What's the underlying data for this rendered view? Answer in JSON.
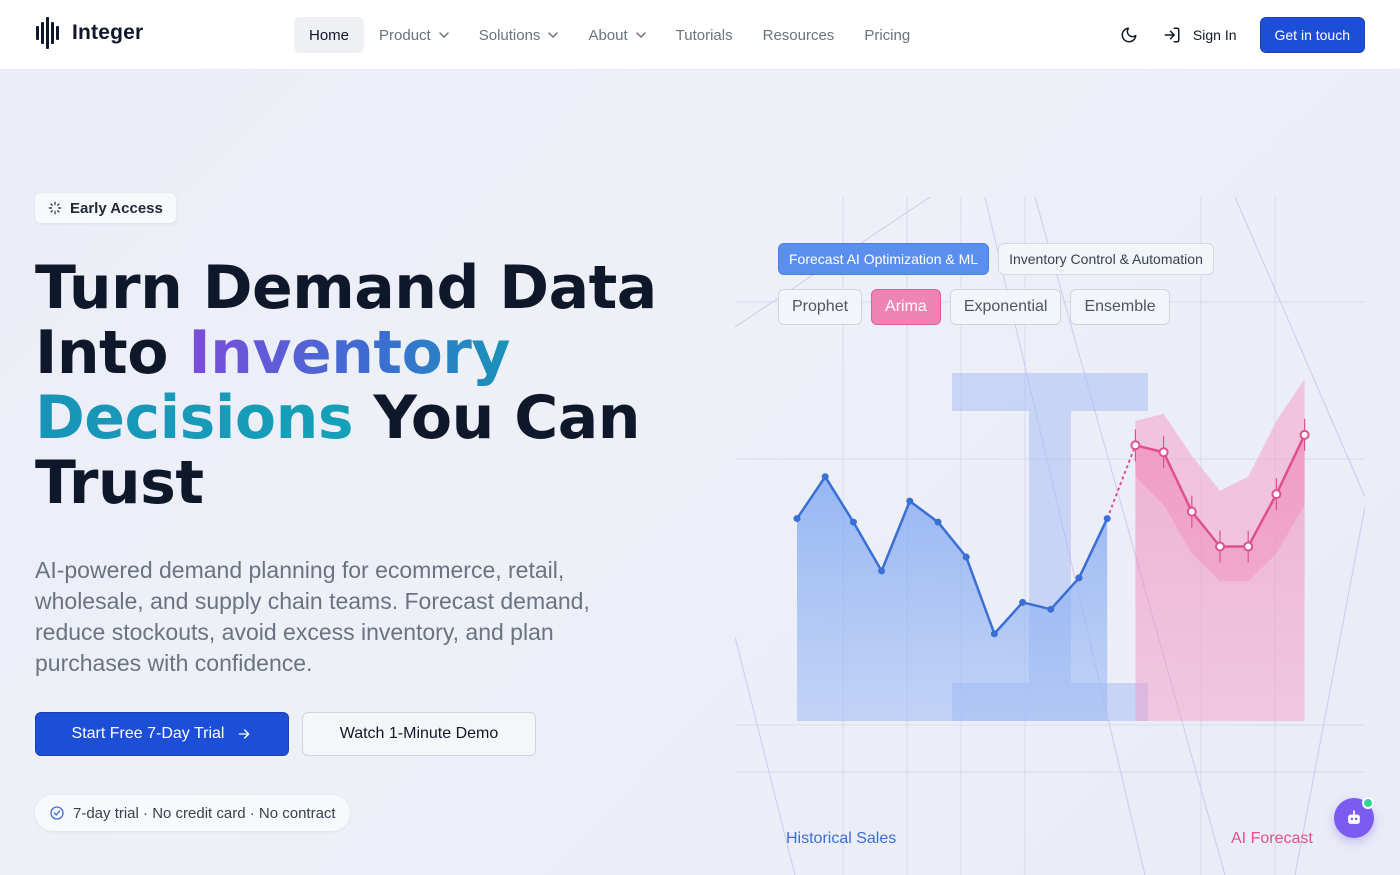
{
  "brand": {
    "name": "Integer"
  },
  "nav": {
    "links": [
      {
        "label": "Home",
        "active": true,
        "dropdown": false
      },
      {
        "label": "Product",
        "active": false,
        "dropdown": true
      },
      {
        "label": "Solutions",
        "active": false,
        "dropdown": true
      },
      {
        "label": "About",
        "active": false,
        "dropdown": true
      },
      {
        "label": "Tutorials",
        "active": false,
        "dropdown": false
      },
      {
        "label": "Resources",
        "active": false,
        "dropdown": false
      },
      {
        "label": "Pricing",
        "active": false,
        "dropdown": false
      }
    ],
    "theme_icon": "moon-icon",
    "signin_label": "Sign In",
    "cta_label": "Get in touch"
  },
  "hero": {
    "badge": "Early Access",
    "headline": {
      "line1": "Turn Demand Data",
      "line2_plain": "Into ",
      "line2_grad": "Inventory",
      "line3_grad": "Decisions",
      "line3_plain": " You Can",
      "line4": "Trust"
    },
    "subtext": "AI-powered demand planning for ecommerce, retail, wholesale, and supply chain teams. Forecast demand, reduce stockouts, avoid excess inventory, and plan purchases with confidence.",
    "primary_cta": "Start Free 7-Day Trial",
    "secondary_cta": "Watch 1-Minute Demo",
    "trust_note": "7-day trial · No credit card · No contract"
  },
  "visual": {
    "tabs": [
      {
        "label": "Forecast AI Optimization & ML",
        "active": true
      },
      {
        "label": "Inventory Control & Automation",
        "active": false
      }
    ],
    "models": [
      {
        "label": "Prophet",
        "active": false
      },
      {
        "label": "Arima",
        "active": true
      },
      {
        "label": "Exponential",
        "active": false
      },
      {
        "label": "Ensemble",
        "active": false
      }
    ],
    "legend_historical": "Historical Sales",
    "legend_forecast": "AI Forecast"
  },
  "colors": {
    "accent": "#1d4ed8",
    "historical": "#3b6fd6",
    "forecast": "#e0508f",
    "chat_bubble": "#7b5cf0"
  },
  "chart_data": {
    "type": "line",
    "title": "",
    "xlabel": "",
    "ylabel": "",
    "series": [
      {
        "name": "Historical Sales",
        "values": [
          0.58,
          0.7,
          0.57,
          0.43,
          0.63,
          0.57,
          0.47,
          0.25,
          0.34,
          0.32,
          0.41,
          0.58
        ]
      },
      {
        "name": "AI Forecast",
        "values": [
          null,
          null,
          null,
          null,
          null,
          null,
          null,
          null,
          null,
          null,
          null,
          0.58,
          0.79,
          0.77,
          0.6,
          0.5,
          0.5,
          0.65,
          0.82
        ]
      }
    ],
    "forecast_band": {
      "lower": [
        0.7,
        0.62,
        0.48,
        0.4,
        0.4,
        0.48,
        0.62
      ],
      "upper": [
        0.86,
        0.88,
        0.76,
        0.66,
        0.7,
        0.86,
        0.98
      ]
    }
  },
  "chat": {
    "icon": "robot-icon"
  }
}
